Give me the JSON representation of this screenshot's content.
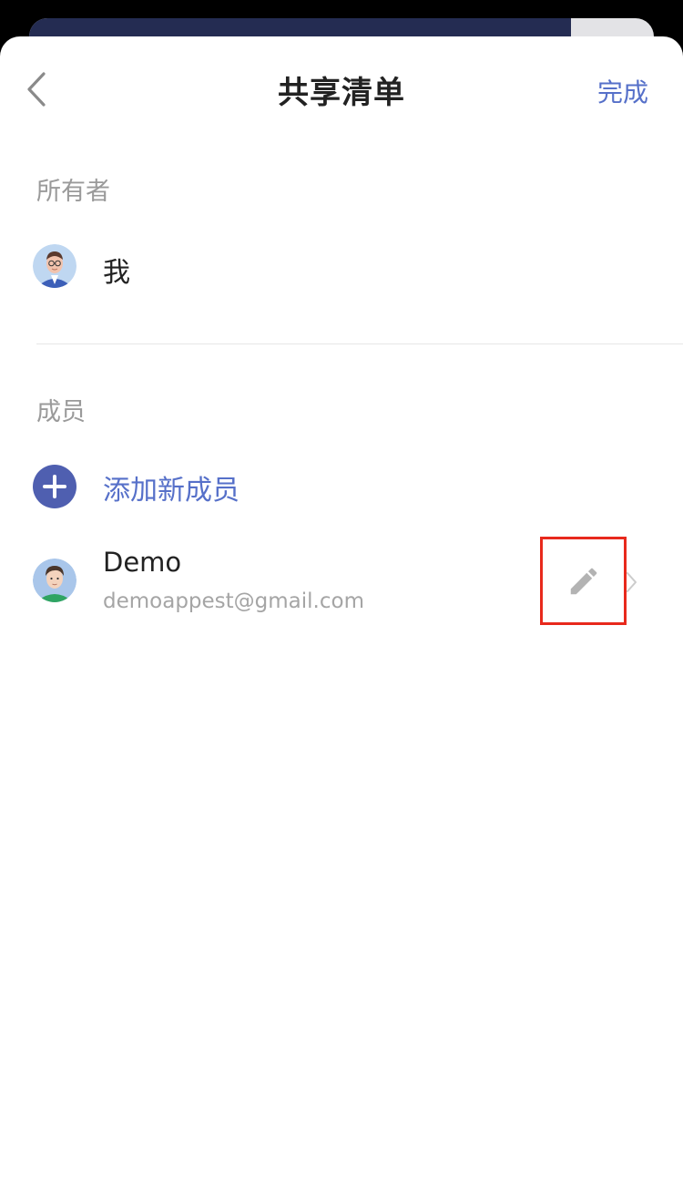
{
  "header": {
    "title": "共享清单",
    "done_label": "完成"
  },
  "owner_section": {
    "label": "所有者",
    "owner_name": "我"
  },
  "members_section": {
    "label": "成员",
    "add_label": "添加新成员",
    "members": [
      {
        "name": "Demo",
        "email": "demoappest@gmail.com"
      }
    ]
  },
  "colors": {
    "accent": "#5670c9",
    "add_icon_bg": "#4f5fb0",
    "highlight_border": "#e8291c"
  },
  "icons": {
    "back": "chevron-left-icon",
    "add": "plus-circle-icon",
    "edit": "pencil-icon",
    "row_arrow": "chevron-right-icon"
  }
}
